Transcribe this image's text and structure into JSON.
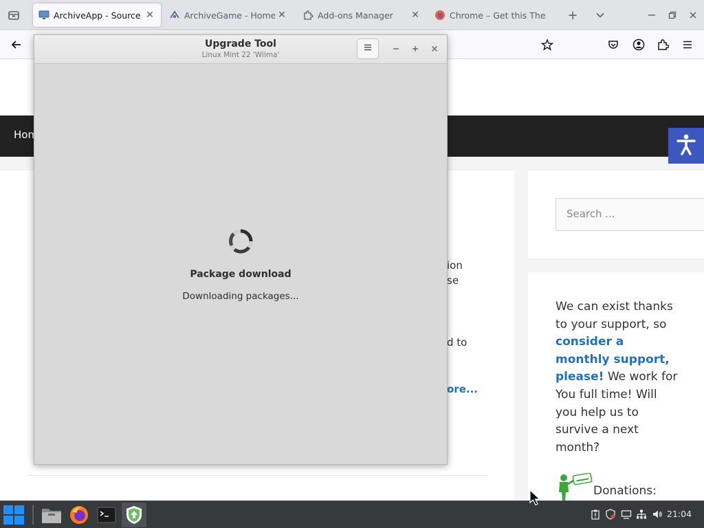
{
  "browser": {
    "tabs": [
      {
        "title": "ArchiveApp - Source of",
        "active": true,
        "icon": "monitor-icon"
      },
      {
        "title": "ArchiveGame - Home",
        "active": false,
        "icon": "globe-icon"
      },
      {
        "title": "Add-ons Manager",
        "active": false,
        "icon": "puzzle-icon"
      },
      {
        "title": "Chrome – Get this The",
        "active": false,
        "icon": "firefox-icon"
      }
    ],
    "new_tab_label": "+"
  },
  "webpage": {
    "nav_home": "Hom",
    "fragments": [
      "ion",
      "se",
      "d to"
    ],
    "read_more": "ore...",
    "search_placeholder": "Search ...",
    "support_text_1": "We can exist thanks to your support, so",
    "support_strong": "consider a monthly support, please!",
    "support_text_2": "We work for You full time! Will you help us to survive a next month?",
    "donations_label": "Donations:",
    "accent_color": "#1e73be",
    "accessibility_color": "#3d57c0"
  },
  "dialog": {
    "title": "Upgrade Tool",
    "subtitle": "Linux Mint 22 'Wilma'",
    "status_title": "Package download",
    "status_text": "Downloading packages..."
  },
  "taskbar": {
    "clock": "21:04"
  }
}
